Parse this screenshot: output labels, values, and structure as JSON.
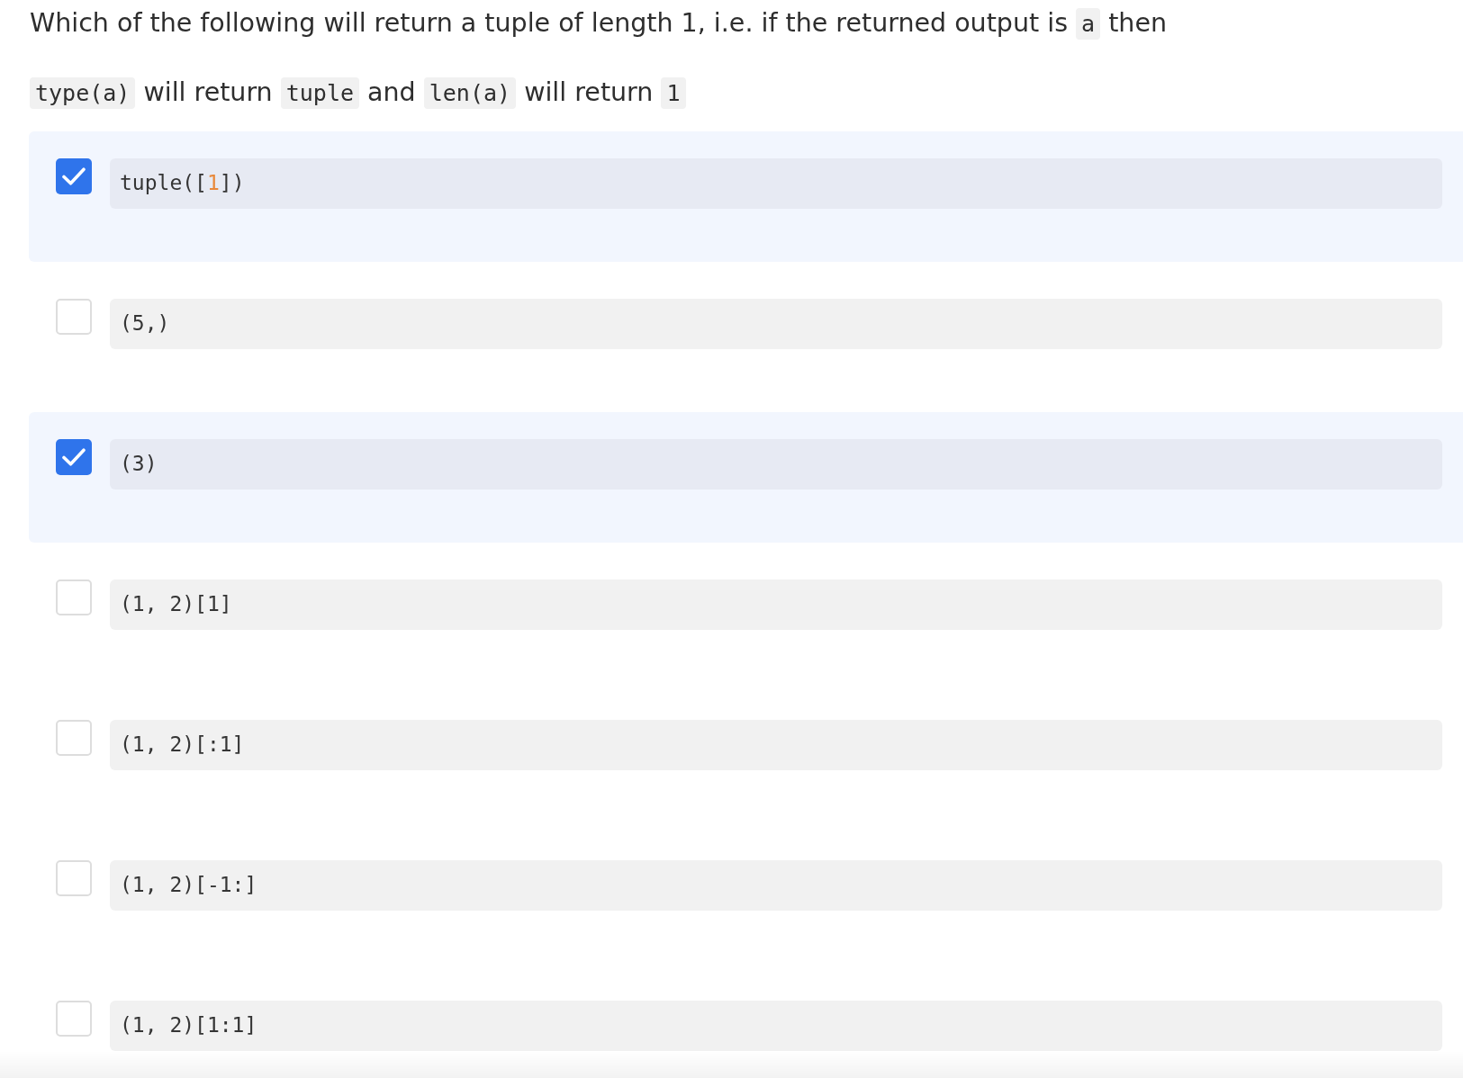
{
  "question": [
    {
      "kind": "text",
      "text": "Which of the following will return a tuple of length 1, i.e. if the returned output is "
    },
    {
      "kind": "code",
      "text": "a"
    },
    {
      "kind": "text",
      "text": " then "
    },
    {
      "kind": "code",
      "text": "type(a)"
    },
    {
      "kind": "text",
      "text": " will return "
    },
    {
      "kind": "code",
      "text": "tuple"
    },
    {
      "kind": "text",
      "text": " and "
    },
    {
      "kind": "code",
      "text": "len(a)"
    },
    {
      "kind": "text",
      "text": " will return "
    },
    {
      "kind": "code",
      "text": "1"
    }
  ],
  "options": [
    {
      "selected": true,
      "code": [
        {
          "kind": "plain",
          "text": "tuple(["
        },
        {
          "kind": "number",
          "text": "1"
        },
        {
          "kind": "plain",
          "text": "])"
        }
      ]
    },
    {
      "selected": false,
      "code": [
        {
          "kind": "plain",
          "text": "(5,)"
        }
      ]
    },
    {
      "selected": true,
      "code": [
        {
          "kind": "plain",
          "text": "(3)"
        }
      ]
    },
    {
      "selected": false,
      "code": [
        {
          "kind": "plain",
          "text": "(1, 2)[1]"
        }
      ]
    },
    {
      "selected": false,
      "code": [
        {
          "kind": "plain",
          "text": "(1, 2)[:1]"
        }
      ]
    },
    {
      "selected": false,
      "code": [
        {
          "kind": "plain",
          "text": "(1, 2)[-1:]"
        }
      ]
    },
    {
      "selected": false,
      "code": [
        {
          "kind": "plain",
          "text": "(1, 2)[1:1]"
        }
      ]
    }
  ]
}
